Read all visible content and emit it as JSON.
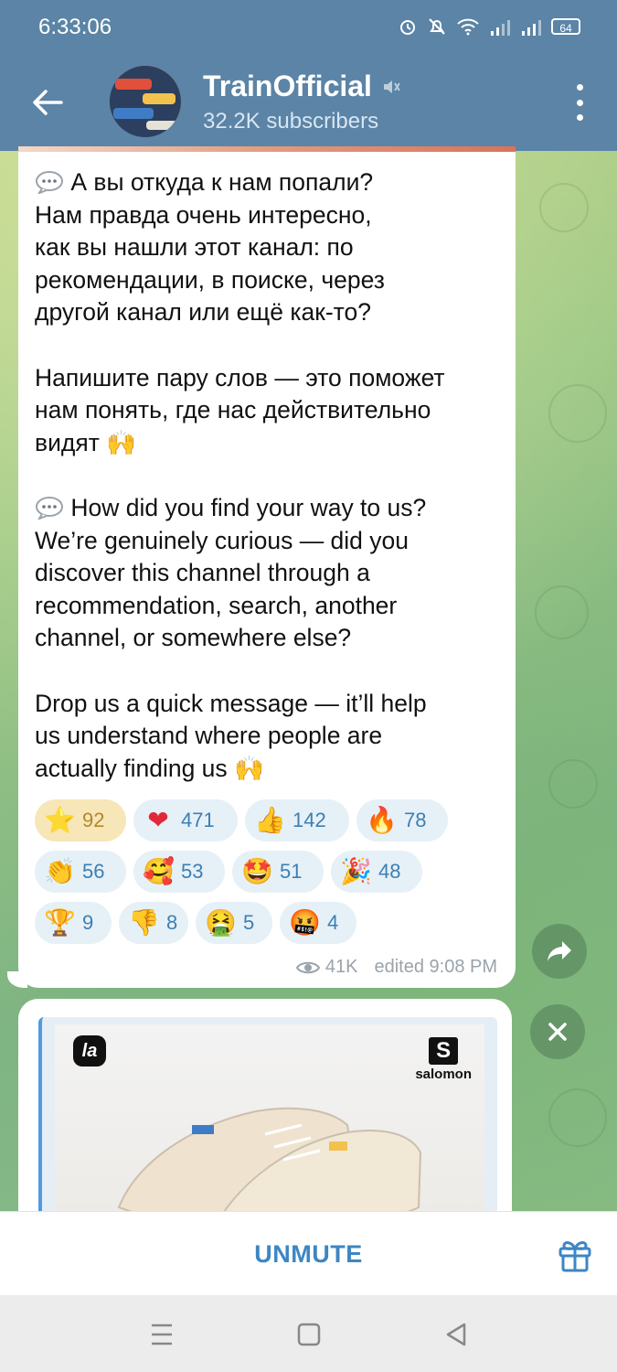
{
  "status_bar": {
    "time": "6:33:06",
    "battery": "64"
  },
  "channel": {
    "name": "TrainOfficial",
    "subscribers": "32.2K subscribers"
  },
  "message": {
    "paragraphs": [
      [
        "А вы откуда к нам попали?",
        "Нам правда очень интересно,",
        "как вы нашли этот канал: по",
        "рекомендации, в поиске, через",
        "другой канал или ещё как-то?"
      ],
      [
        "Напишите пару слов — это поможет",
        "нам понять, где нас действительно",
        "видят"
      ],
      [
        "How did you find your way to us?",
        "We’re genuinely curious — did you",
        "discover this channel through a",
        "recommendation, search, another",
        "channel, or somewhere else?"
      ],
      [
        "Drop us a quick message — it’ll help",
        "us understand where people are",
        "actually finding us"
      ]
    ],
    "reactions": [
      {
        "emoji": "⭐",
        "count": "92"
      },
      {
        "emoji": "❤",
        "count": "471"
      },
      {
        "emoji": "👍",
        "count": "142"
      },
      {
        "emoji": "🔥",
        "count": "78"
      },
      {
        "emoji": "👏",
        "count": "56"
      },
      {
        "emoji": "🥰",
        "count": "53"
      },
      {
        "emoji": "🤩",
        "count": "51"
      },
      {
        "emoji": "🎉",
        "count": "48"
      },
      {
        "emoji": "🏆",
        "count": "9"
      },
      {
        "emoji": "👎",
        "count": "8"
      },
      {
        "emoji": "🤮",
        "count": "5"
      },
      {
        "emoji": "🤬",
        "count": "4"
      }
    ],
    "views": "41K",
    "edited": "edited 9:08 PM"
  },
  "preview": {
    "left_logo": "la",
    "brand_letter": "S",
    "brand_word": "salomon"
  },
  "bottom": {
    "unmute_label": "UNMUTE"
  },
  "icons": {
    "back": "arrow-left-icon",
    "mute": "muted-speaker-icon",
    "menu": "more-vertical-icon",
    "share": "share-arrow-icon",
    "close": "close-icon",
    "gift": "gift-icon",
    "views": "eye-icon"
  },
  "colors": {
    "header": "#5b84a6",
    "accent": "#3d86c4",
    "reaction_bg": "#e6f0f7",
    "reaction_active_bg": "#f7e6b8"
  }
}
